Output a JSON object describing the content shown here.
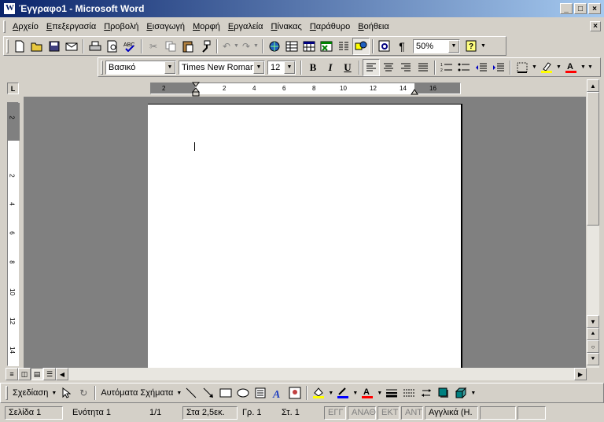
{
  "window": {
    "title": "Έγγραφο1 - Microsoft Word"
  },
  "menu": {
    "items": [
      "Αρχείο",
      "Επεξεργασία",
      "Προβολή",
      "Εισαγωγή",
      "Μορφή",
      "Εργαλεία",
      "Πίνακας",
      "Παράθυρο",
      "Βοήθεια"
    ]
  },
  "standard_toolbar": {
    "zoom": "50%"
  },
  "formatting_toolbar": {
    "style": "Βασικό",
    "font": "Times New Roman",
    "size": "12",
    "bold": "B",
    "italic": "I",
    "underline": "U"
  },
  "ruler": {
    "horizontal_ticks": [
      "2",
      "2",
      "4",
      "6",
      "8",
      "10",
      "12",
      "14",
      "16"
    ],
    "vertical_ticks": [
      "2",
      "2",
      "4",
      "6",
      "8",
      "10",
      "12",
      "14"
    ],
    "corner": "L"
  },
  "drawing_toolbar": {
    "draw_label": "Σχεδίαση",
    "autoshapes_label": "Αυτόματα Σχήματα"
  },
  "status": {
    "page": "Σελίδα  1",
    "section": "Ενότητα  1",
    "pages": "1/1",
    "at": "Στα 2,5εκ.",
    "line": "Γρ.  1",
    "column": "Στ.  1",
    "rec": "ΕΓΓ",
    "trk": "ΑΝΑΘ",
    "ext": "ΕΚΤ",
    "ovr": "ΑΝΤ",
    "language": "Αγγλικά (Η."
  },
  "colors": {
    "title_start": "#0a246a",
    "title_end": "#a6caf0",
    "face": "#d4d0c8",
    "workspace": "#808080",
    "highlight": "#ffff00",
    "font_color": "#ff0000"
  }
}
